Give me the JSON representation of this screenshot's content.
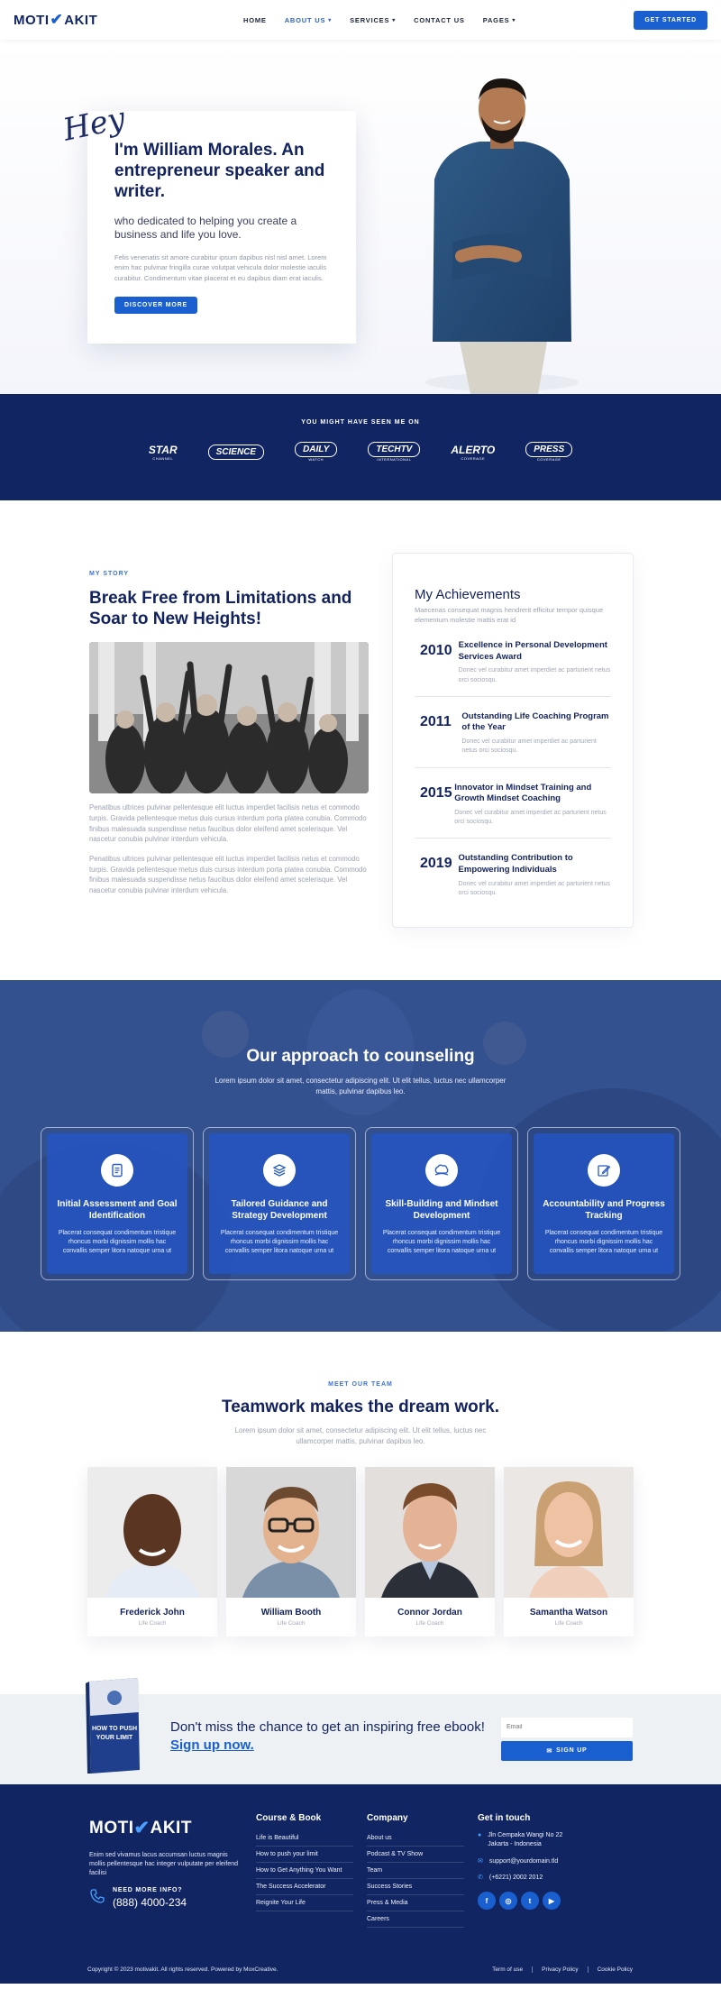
{
  "header": {
    "logo_left": "MOTI",
    "logo_right": "AKIT",
    "nav": [
      {
        "label": "HOME",
        "dropdown": false
      },
      {
        "label": "ABOUT US",
        "dropdown": true
      },
      {
        "label": "SERVICES",
        "dropdown": true
      },
      {
        "label": "CONTACT US",
        "dropdown": false
      },
      {
        "label": "PAGES",
        "dropdown": true
      }
    ],
    "cta": "GET STARTED"
  },
  "hero": {
    "hey": "Hey",
    "title": "I'm William Morales. An entrepreneur speaker and writer.",
    "subtitle": "who dedicated to helping you create a business and life you love.",
    "body": "Felis venenatis sit amore curabitur ipsum dapibus nisl nisl amet. Lorem enim hac pulvinar fringilla curae volutpat vehicula dolor molestie iaculis curabitur. Condimentum vitae placerat et eu dapibus diam erat iaculis.",
    "button": "DISCOVER MORE"
  },
  "seen": {
    "title": "YOU MIGHT HAVE SEEN ME ON",
    "logos": [
      {
        "name": "STAR",
        "tag": "CHANNEL"
      },
      {
        "name": "SCIENCE",
        "tag": ""
      },
      {
        "name": "DAILY",
        "tag": "WATCH"
      },
      {
        "name": "TECHTV",
        "tag": "INTERNATIONAL"
      },
      {
        "name": "ALERTO",
        "tag": "COVERAGE"
      },
      {
        "name": "PRESS",
        "tag": "COVERAGE"
      }
    ]
  },
  "story": {
    "eyebrow": "MY STORY",
    "title": "Break Free from Limitations and Soar to New Heights!",
    "paragraphs": [
      "Penatibus ultrices pulvinar pellentesque elit luctus imperdiet facilisis netus et commodo turpis. Gravida pellentesque metus duis cursus interdum porta platea conubia. Commodo finibus malesuada suspendisse netus faucibus dolor eleifend amet scelerisque. Vel nascetur conubia pulvinar interdum vehicula.",
      "Penatibus ultrices pulvinar pellentesque elit luctus imperdiet facilisis netus et commodo turpis. Gravida pellentesque metus duis cursus interdum porta platea conubia. Commodo finibus malesuada suspendisse netus faucibus dolor eleifend amet scelerisque. Vel nascetur conubia pulvinar interdum vehicula."
    ]
  },
  "achievements": {
    "title": "My Achievements",
    "subtitle": "Maecenas consequat magnis hendrerit efficitur tempor quisque elementum molestie mattis erat id",
    "items": [
      {
        "year": "2010",
        "name": "Excellence in Personal Development Services Award",
        "desc": "Donec vel curabitur amet imperdiet ac parturient netus orci sociosqu."
      },
      {
        "year": "2011",
        "name": "Outstanding Life Coaching Program of the Year",
        "desc": "Donec vel curabitur amet imperdiet ac parturient netus orci sociosqu."
      },
      {
        "year": "2015",
        "name": "Innovator in Mindset Training and Growth Mindset Coaching",
        "desc": "Donec vel curabitur amet imperdiet ac parturient netus orci sociosqu."
      },
      {
        "year": "2019",
        "name": "Outstanding Contribution to Empowering Individuals",
        "desc": "Donec vel curabitur amet imperdiet ac parturient netus orci sociosqu."
      }
    ]
  },
  "approach": {
    "title": "Our approach to counseling",
    "subtitle": "Lorem ipsum dolor sit amet, consectetur adipiscing elit. Ut elit tellus, luctus nec ullamcorper mattis, pulvinar dapibus leo.",
    "cards": [
      {
        "icon": "document-icon",
        "title": "Initial Assessment and Goal Identification",
        "desc": "Placerat consequat condimentum tristique rhoncus morbi dignissim mollis hac convallis semper litora natoque urna ut"
      },
      {
        "icon": "layers-icon",
        "title": "Tailored Guidance and Strategy Development",
        "desc": "Placerat consequat condimentum tristique rhoncus morbi dignissim mollis hac convallis semper litora natoque urna ut"
      },
      {
        "icon": "brain-icon",
        "title": "Skill-Building and Mindset Development",
        "desc": "Placerat consequat condimentum tristique rhoncus morbi dignissim mollis hac convallis semper litora natoque urna ut"
      },
      {
        "icon": "edit-icon",
        "title": "Accountability and Progress Tracking",
        "desc": "Placerat consequat condimentum tristique rhoncus morbi dignissim mollis hac convallis semper litora natoque urna ut"
      }
    ]
  },
  "team": {
    "eyebrow": "MEET OUR TEAM",
    "title": "Teamwork makes the dream work.",
    "subtitle": "Lorem ipsum dolor sit amet, consectetur adipiscing elit. Ut elit tellus, luctus nec ullamcorper mattis, pulvinar dapibus leo.",
    "members": [
      {
        "name": "Frederick John",
        "role": "Life Coach"
      },
      {
        "name": "William Booth",
        "role": "Life Coach"
      },
      {
        "name": "Connor Jordan",
        "role": "Life Coach"
      },
      {
        "name": "Samantha Watson",
        "role": "Life Coach"
      }
    ]
  },
  "newsletter": {
    "book_title": "HOW TO PUSH YOUR LIMIT",
    "text": "Don't miss the chance to get an inspiring free ebook!",
    "link": "Sign up now.",
    "placeholder": "Email",
    "button": "SIGN UP"
  },
  "footer": {
    "logo_left": "MOTI",
    "logo_right": "AKIT",
    "about": "Enim sed vivamus lacus accumsan luctus magnis mollis pellentesque hac integer vulputate per eleifend facilisi",
    "phone_label": "NEED MORE INFO?",
    "phone": "(888) 4000-234",
    "col1_title": "Course & Book",
    "col1": [
      "Life is Beautiful",
      "How to push your limit",
      "How to Get Anything You Want",
      "The Success Accelerator",
      "Reignite Your Life"
    ],
    "col2_title": "Company",
    "col2": [
      "About us",
      "Podcast & TV Show",
      "Team",
      "Success Stories",
      "Press & Media",
      "Careers"
    ],
    "col3_title": "Get in touch",
    "address": "Jln Cempaka Wangi No 22 Jakarta - Indonesia",
    "email": "support@yourdomain.tld",
    "tel": "(+6221) 2002 2012",
    "copyright": "Copyright © 2023 motivakit. All rights reserved. Powered by MoxCreative.",
    "links": [
      "Term of use",
      "Privacy Policy",
      "Cookie Policy"
    ]
  },
  "colors": {
    "navy": "#112562",
    "primary": "#1a5fd0",
    "accent_blue": "#3c72d8"
  }
}
